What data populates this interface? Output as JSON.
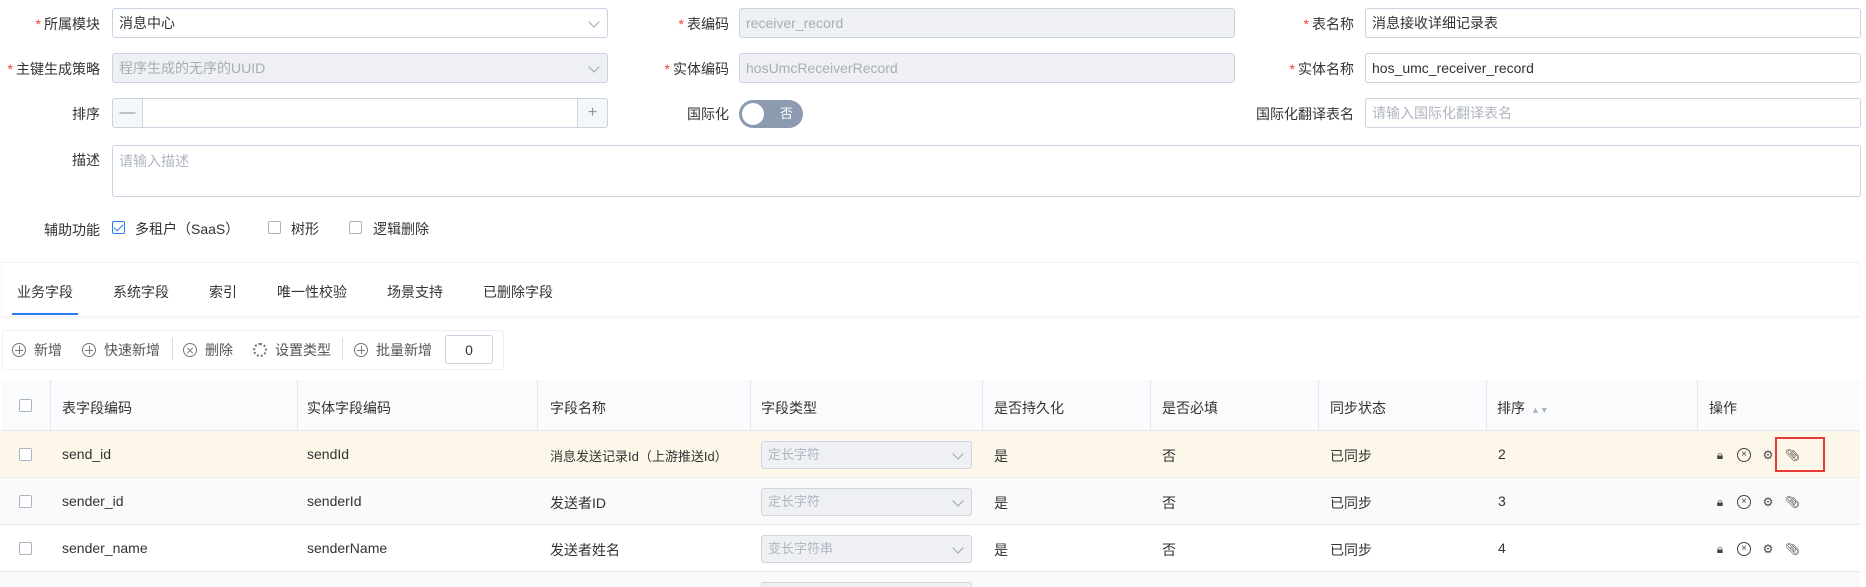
{
  "form": {
    "module_label": "所属模块",
    "module_value": "消息中心",
    "table_code_label": "表编码",
    "table_code_value": "receiver_record",
    "table_name_label": "表名称",
    "table_name_value": "消息接收详细记录表",
    "pk_label": "主键生成策略",
    "pk_value": "程序生成的无序的UUID",
    "entity_code_label": "实体编码",
    "entity_code_value": "hosUmcReceiverRecord",
    "entity_name_label": "实体名称",
    "entity_name_value": "hos_umc_receiver_record",
    "sort_label": "排序",
    "sort_minus": "—",
    "sort_plus": "+",
    "i18n_label": "国际化",
    "i18n_toggle_text": "否",
    "i18n_table_label": "国际化翻译表名",
    "i18n_table_placeholder": "请输入国际化翻译表名",
    "desc_label": "描述",
    "desc_placeholder": "请输入描述",
    "aux_label": "辅助功能",
    "aux_options": [
      {
        "label": "多租户（SaaS）",
        "checked": true
      },
      {
        "label": "树形",
        "checked": false
      },
      {
        "label": "逻辑删除",
        "checked": false
      }
    ]
  },
  "tabs": [
    "业务字段",
    "系统字段",
    "索引",
    "唯一性校验",
    "场景支持",
    "已删除字段"
  ],
  "toolbar": {
    "add": "新增",
    "quick_add": "快速新增",
    "delete": "删除",
    "set_type": "设置类型",
    "batch_add": "批量新增",
    "batch_count": "0"
  },
  "table": {
    "headers": [
      "表字段编码",
      "实体字段编码",
      "字段名称",
      "字段类型",
      "是否持久化",
      "是否必填",
      "同步状态",
      "排序",
      "操作"
    ],
    "rows": [
      {
        "code": "send_id",
        "entity": "sendId",
        "name": "消息发送记录Id（上游推送Id）",
        "type": "定长字符",
        "persist": "是",
        "required": "否",
        "sync": "已同步",
        "sort": "2"
      },
      {
        "code": "sender_id",
        "entity": "senderId",
        "name": "发送者ID",
        "type": "定长字符",
        "persist": "是",
        "required": "否",
        "sync": "已同步",
        "sort": "3"
      },
      {
        "code": "sender_name",
        "entity": "senderName",
        "name": "发送者姓名",
        "type": "变长字符串",
        "persist": "是",
        "required": "否",
        "sync": "已同步",
        "sort": "4"
      }
    ]
  },
  "colors": {
    "accent": "#2d7cf0",
    "required": "#f04134",
    "highlight_row": "#fdf7ea",
    "highlight_box": "#e53935"
  }
}
